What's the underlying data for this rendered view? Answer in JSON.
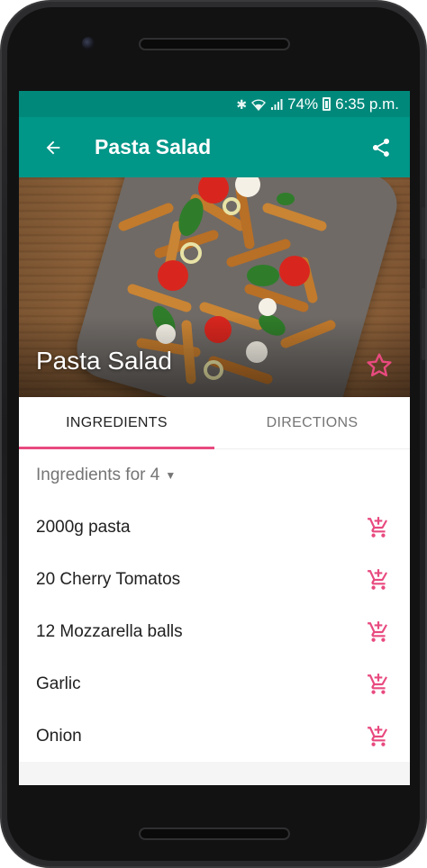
{
  "status_bar": {
    "battery_percent": "74%",
    "time": "6:35 p.m."
  },
  "app_bar": {
    "title": "Pasta Salad",
    "back_icon": "arrow-back-icon",
    "share_icon": "share-icon"
  },
  "hero": {
    "recipe_title": "Pasta Salad",
    "favorite_icon": "star-outline-icon"
  },
  "tabs": [
    {
      "label": "INGREDIENTS",
      "selected": true
    },
    {
      "label": "DIRECTIONS",
      "selected": false
    }
  ],
  "servings": {
    "label": "Ingredients for 4"
  },
  "ingredients": [
    {
      "name": "2000g pasta"
    },
    {
      "name": "20 Cherry Tomatos"
    },
    {
      "name": "12 Mozzarella balls"
    },
    {
      "name": "Garlic"
    },
    {
      "name": "Onion"
    }
  ],
  "colors": {
    "primary": "#009688",
    "primary_dark": "#00897b",
    "accent": "#e84a7f"
  }
}
